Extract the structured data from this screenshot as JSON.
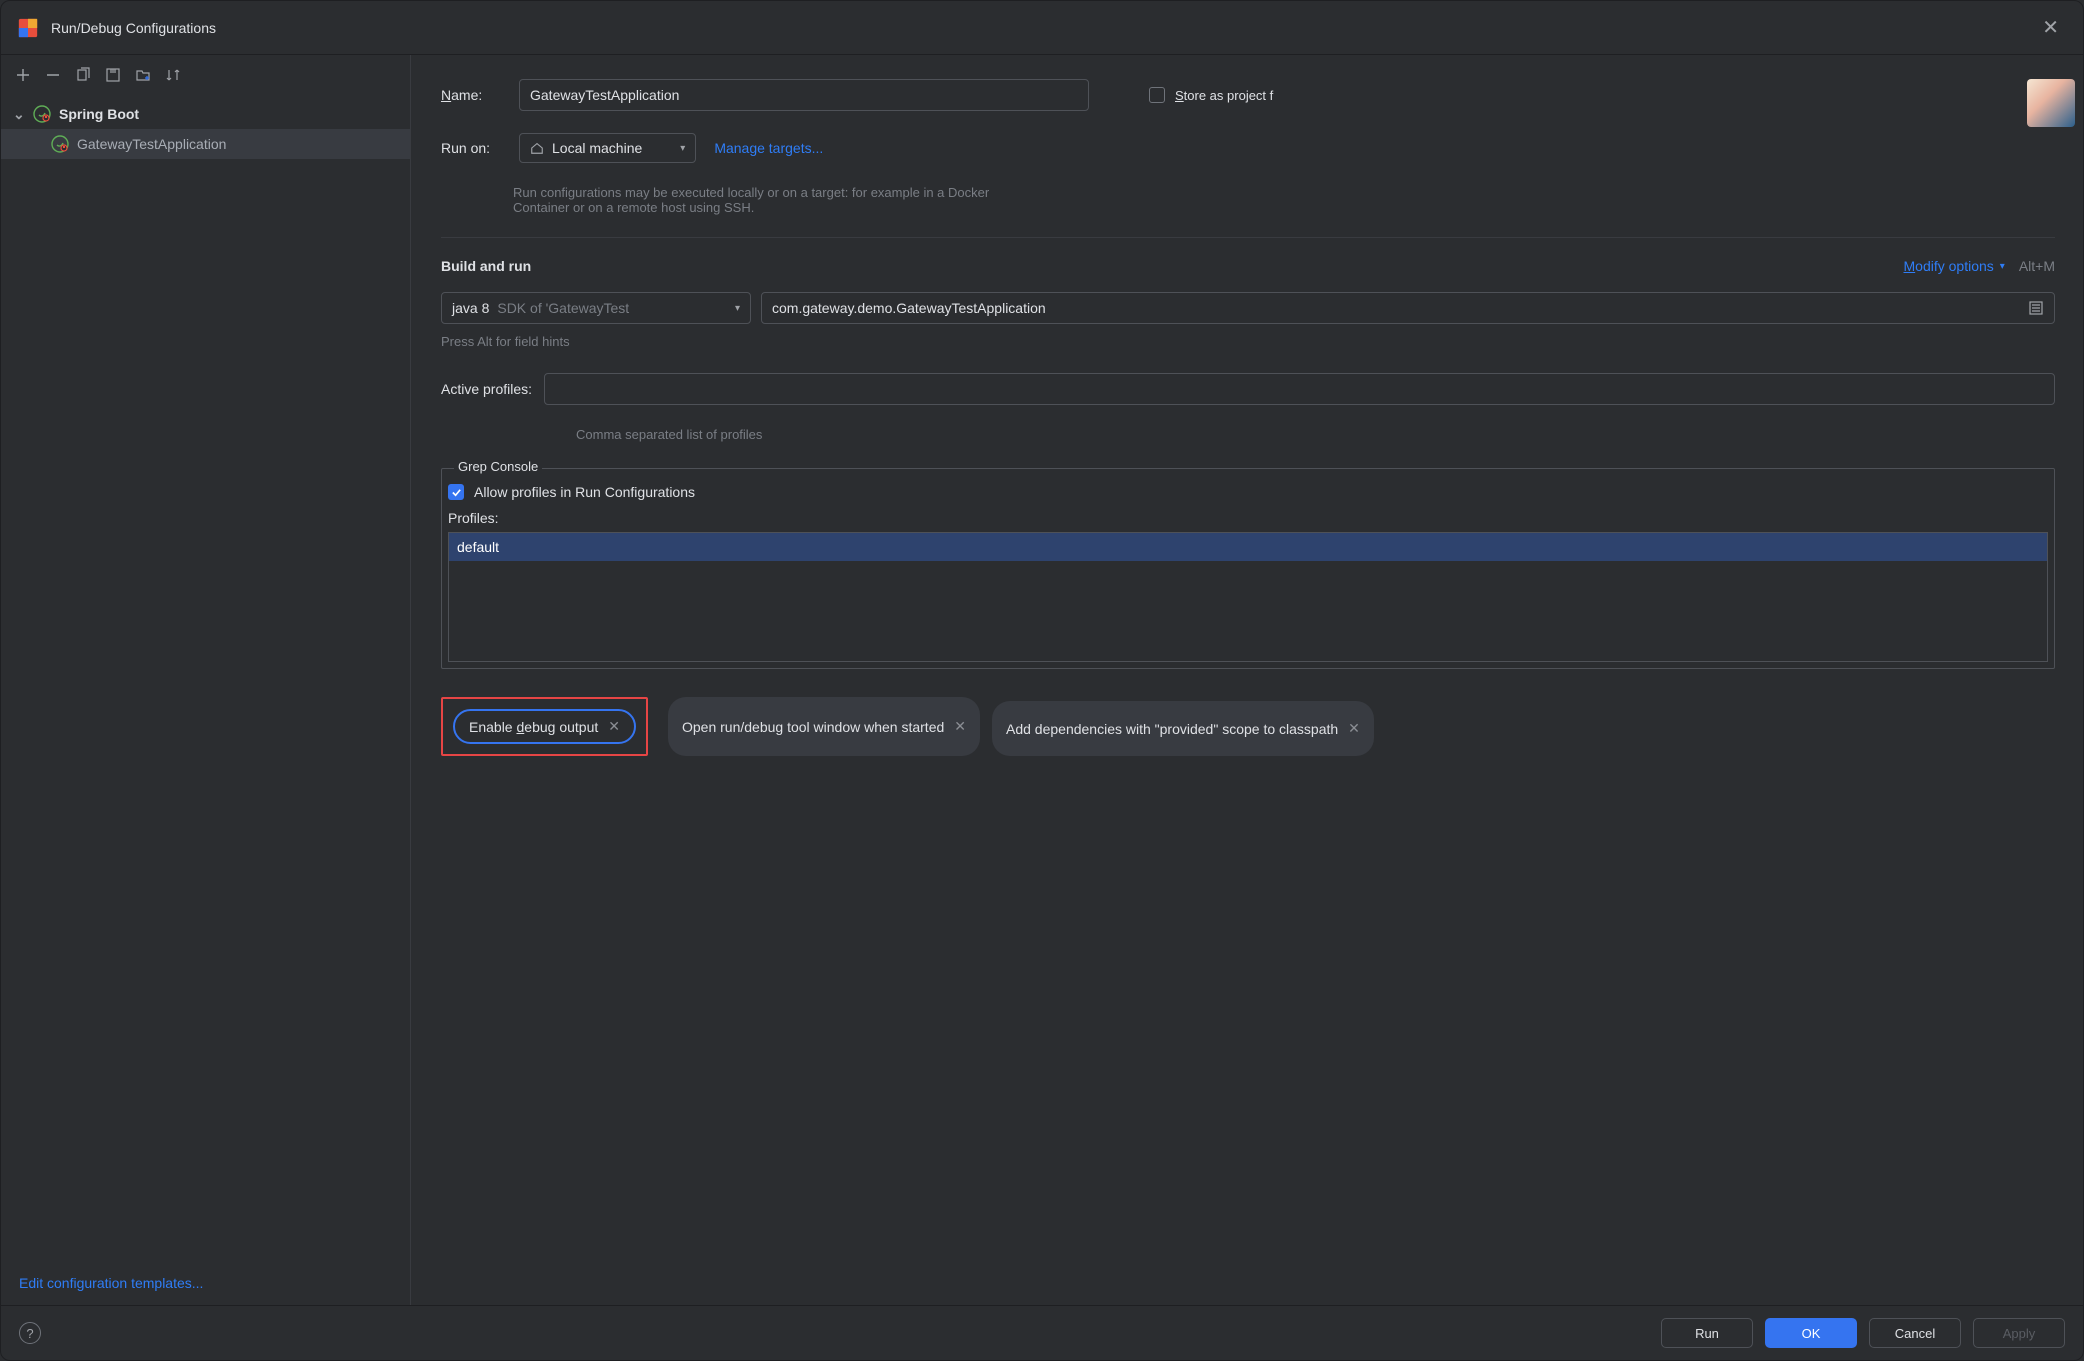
{
  "titlebar": {
    "title": "Run/Debug Configurations"
  },
  "tree": {
    "parent_label": "Spring Boot",
    "child_label": "GatewayTestApplication"
  },
  "sidebar_footer": {
    "edit_templates": "Edit configuration templates..."
  },
  "form": {
    "name_label": "ame:",
    "name_value": "GatewayTestApplication",
    "store_label": "tore as project f",
    "run_on_label": "Run on:",
    "run_on_value": "Local machine",
    "manage_targets": "Manage targets...",
    "run_help": "Run configurations may be executed locally or on a target: for example in a Docker Container or on a remote host using SSH.",
    "section_build": "Build and run",
    "modify_options": "odify options",
    "modify_shortcut": "Alt+M",
    "sdk_value": "java 8",
    "sdk_hint": "SDK of 'GatewayTest",
    "main_class": "com.gateway.demo.GatewayTestApplication",
    "field_hints": "Press Alt for field hints",
    "active_profiles_label": "Active profiles:",
    "active_profiles_hint": "Comma separated list of profiles",
    "grep_legend": "Grep Console",
    "allow_profiles": "Allow profiles in Run Configurations",
    "profiles_label": "Profiles:",
    "profiles_item": "default",
    "chip1": "Enable debug output",
    "chip1_u": "d",
    "chip2": "Open run/debug tool window when started",
    "chip3": "Add dependencies with \"provided\" scope to classpath"
  },
  "buttons": {
    "run": "Run",
    "ok": "OK",
    "cancel": "Cancel",
    "apply": "Apply"
  }
}
